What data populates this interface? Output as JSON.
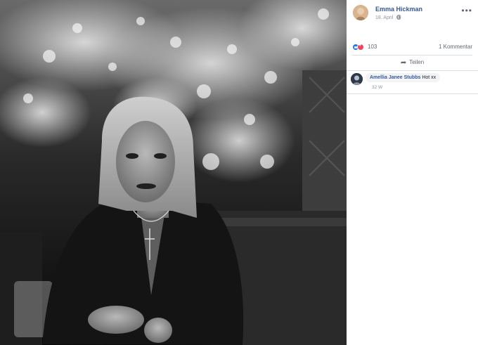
{
  "post": {
    "author": "Emma Hickman",
    "date": "18. April",
    "privacy_icon": "globe-icon",
    "more_icon": "ellipsis-icon"
  },
  "reactions": {
    "types": [
      "like",
      "love"
    ],
    "count": "103",
    "comments": "1 Kommentar"
  },
  "actions": {
    "share_label": "Teilen",
    "share_icon": "share-arrow-icon"
  },
  "comment": {
    "author": "Amellia Janee Stubbs",
    "text": "Hot xx",
    "time": "32 W"
  },
  "colors": {
    "name_link": "#385898",
    "like": "#2078f4",
    "love": "#f3425f",
    "muted": "#90949c"
  }
}
